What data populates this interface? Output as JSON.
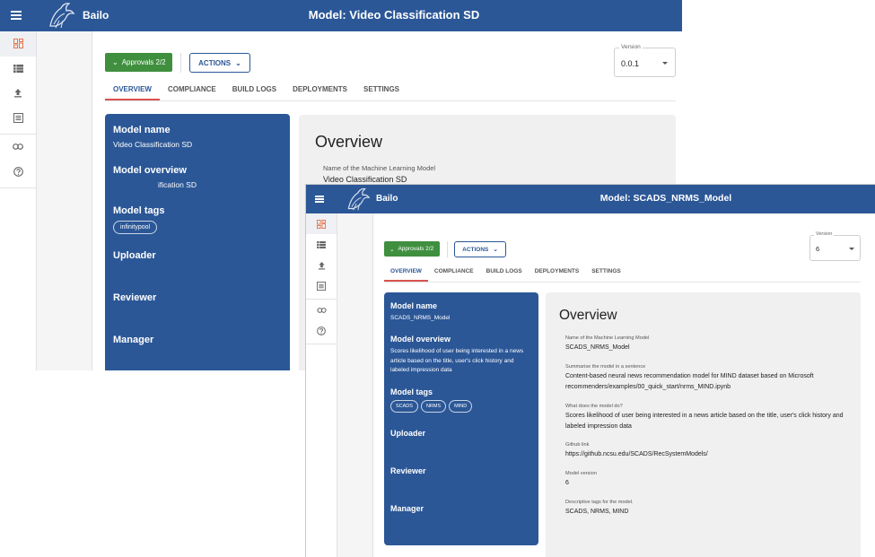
{
  "colors": {
    "primary": "#2b5797",
    "approval_green": "#3f8f3f",
    "tab_underline": "#d9534f"
  },
  "windows": [
    {
      "app_name": "Bailo",
      "page_title": "Model: Video Classification SD",
      "nav_icons": [
        "dashboard-icon",
        "models-icon",
        "upload-icon",
        "list-icon",
        "link-icon",
        "help-icon"
      ],
      "approvals_label": "Approvals 2/2",
      "actions_label": "ACTIONS",
      "version": {
        "label": "Version",
        "value": "0.0.1"
      },
      "tabs": [
        "OVERVIEW",
        "COMPLIANCE",
        "BUILD LOGS",
        "DEPLOYMENTS",
        "SETTINGS"
      ],
      "summary": {
        "model_name_heading": "Model name",
        "model_name": "Video Classification SD",
        "model_overview_heading": "Model overview",
        "model_overview": "ification SD",
        "model_tags_heading": "Model tags",
        "tags": [
          "infinitypool"
        ],
        "uploader_heading": "Uploader",
        "reviewer_heading": "Reviewer",
        "manager_heading": "Manager"
      },
      "overview": {
        "heading": "Overview",
        "fields": [
          {
            "label": "Name of the Machine Learning Model",
            "value": "Video Classification SD"
          }
        ]
      }
    },
    {
      "app_name": "Bailo",
      "page_title": "Model: SCADS_NRMS_Model",
      "nav_icons": [
        "dashboard-icon",
        "models-icon",
        "upload-icon",
        "list-icon",
        "link-icon",
        "help-icon"
      ],
      "approvals_label": "Approvals 2/2",
      "actions_label": "ACTIONS",
      "version": {
        "label": "Version",
        "value": "6"
      },
      "tabs": [
        "OVERVIEW",
        "COMPLIANCE",
        "BUILD LOGS",
        "DEPLOYMENTS",
        "SETTINGS"
      ],
      "summary": {
        "model_name_heading": "Model name",
        "model_name": "SCADS_NRMS_Model",
        "model_overview_heading": "Model overview",
        "model_overview": "Scores likelihood of user being interested in a news article based on the title, user's click history and labeled impression data",
        "model_tags_heading": "Model tags",
        "tags": [
          "SCADS",
          "NRMS",
          "MIND"
        ],
        "uploader_heading": "Uploader",
        "reviewer_heading": "Reviewer",
        "manager_heading": "Manager"
      },
      "overview": {
        "heading": "Overview",
        "fields": [
          {
            "label": "Name of the Machine Learning Model",
            "value": "SCADS_NRMS_Model"
          },
          {
            "label": "Summarise the model in a sentence",
            "value": "Content-based neural news recommendation model for MIND dataset based on Microsoft recommenders/examples/00_quick_start/nrms_MIND.ipynb"
          },
          {
            "label": "What does the model do?",
            "value": "Scores likelihood of user being interested in a news article based on the title, user's click history and labeled impression data"
          },
          {
            "label": "Github link",
            "value": "https://github.ncsu.edu/SCADS/RecSystemModels/"
          },
          {
            "label": "Model version",
            "value": "6"
          },
          {
            "label": "Descriptive tags for the model.",
            "value": "SCADS, NRMS, MIND"
          }
        ]
      }
    }
  ]
}
